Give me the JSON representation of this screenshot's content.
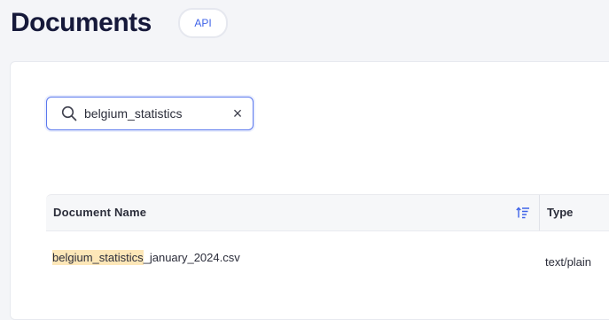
{
  "header": {
    "title": "Documents",
    "api_badge": "API"
  },
  "search": {
    "value": "belgium_statistics",
    "clear_glyph": "×",
    "icon": "search-icon"
  },
  "table": {
    "columns": [
      {
        "label": "Document Name",
        "sort_icon": "sort-ascending-icon"
      },
      {
        "label": "Type"
      }
    ],
    "rows": [
      {
        "name_highlight": "belgium_statistics",
        "name_rest": "_january_2024.csv",
        "type": "text/plain"
      }
    ]
  },
  "colors": {
    "accent": "#3f63e8",
    "highlight": "#fde7b8",
    "title": "#16193a"
  }
}
